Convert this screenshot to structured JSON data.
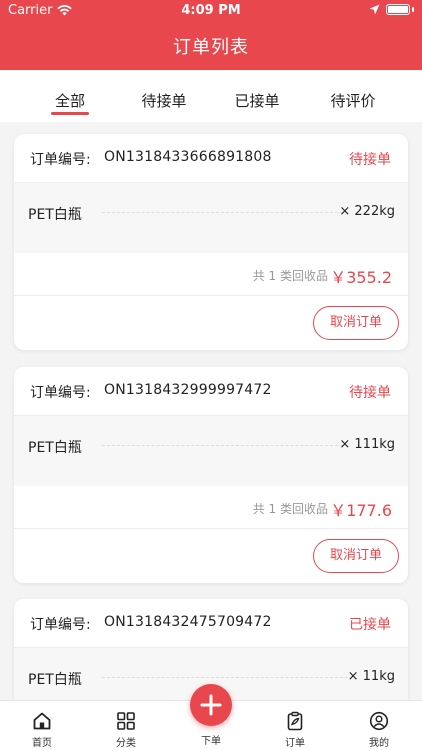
{
  "status_bar": {
    "carrier": "Carrier",
    "time": "4:09 PM"
  },
  "header": {
    "title": "订单列表"
  },
  "tabs": [
    {
      "label": "全部",
      "active": true
    },
    {
      "label": "待接单",
      "active": false
    },
    {
      "label": "已接单",
      "active": false
    },
    {
      "label": "待评价",
      "active": false
    }
  ],
  "orders": [
    {
      "label": "订单编号:",
      "number": "ON1318433666891808",
      "status": "待接单",
      "item_name": "PET白瓶",
      "item_qty": "× 222kg",
      "summary": "共 1 类回收品",
      "price": "￥355.2",
      "action": "取消订单"
    },
    {
      "label": "订单编号:",
      "number": "ON1318432999997472",
      "status": "待接单",
      "item_name": "PET白瓶",
      "item_qty": "× 111kg",
      "summary": "共 1 类回收品",
      "price": "￥177.6",
      "action": "取消订单"
    },
    {
      "label": "订单编号:",
      "number": "ON1318432475709472",
      "status": "已接单",
      "item_name": "PET白瓶",
      "item_qty": "× 11kg"
    }
  ],
  "tabbar": [
    {
      "label": "首页",
      "icon": "home-icon"
    },
    {
      "label": "分类",
      "icon": "grid-icon"
    },
    {
      "label": "下单",
      "icon": "plus-icon"
    },
    {
      "label": "订单",
      "icon": "order-icon"
    },
    {
      "label": "我的",
      "icon": "user-icon"
    }
  ],
  "colors": {
    "accent": "#e8474d",
    "background": "#f4f4f4"
  }
}
